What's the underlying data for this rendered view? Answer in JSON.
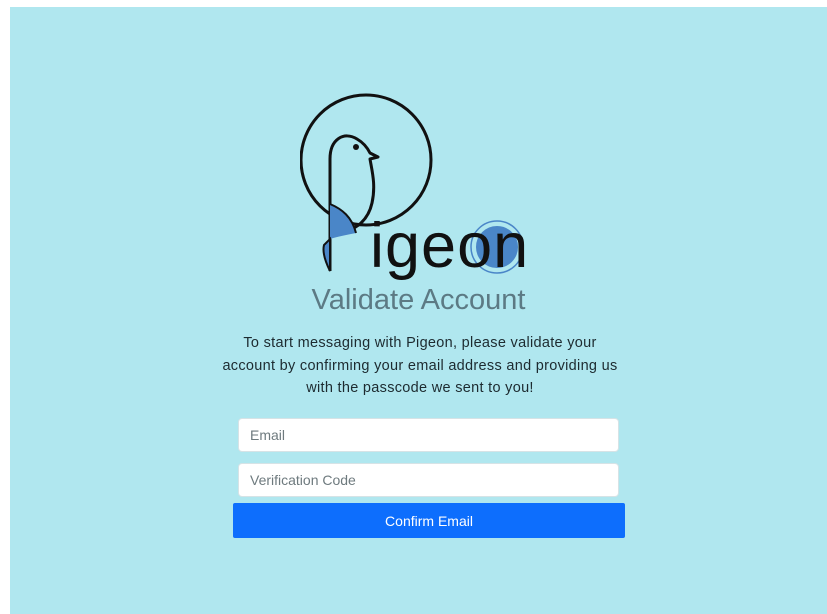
{
  "brand": {
    "name": "Pigeon",
    "logo_text": "igeon",
    "accent_color": "#4a86c8"
  },
  "title": "Validate Account",
  "description": "To start messaging with Pigeon, please validate your account by confirming your email address and providing us with the passcode we sent to you!",
  "form": {
    "email_placeholder": "Email",
    "code_placeholder": "Verification Code",
    "submit_label": "Confirm Email"
  },
  "colors": {
    "background": "#b0e7ef",
    "button": "#0d6efd"
  }
}
